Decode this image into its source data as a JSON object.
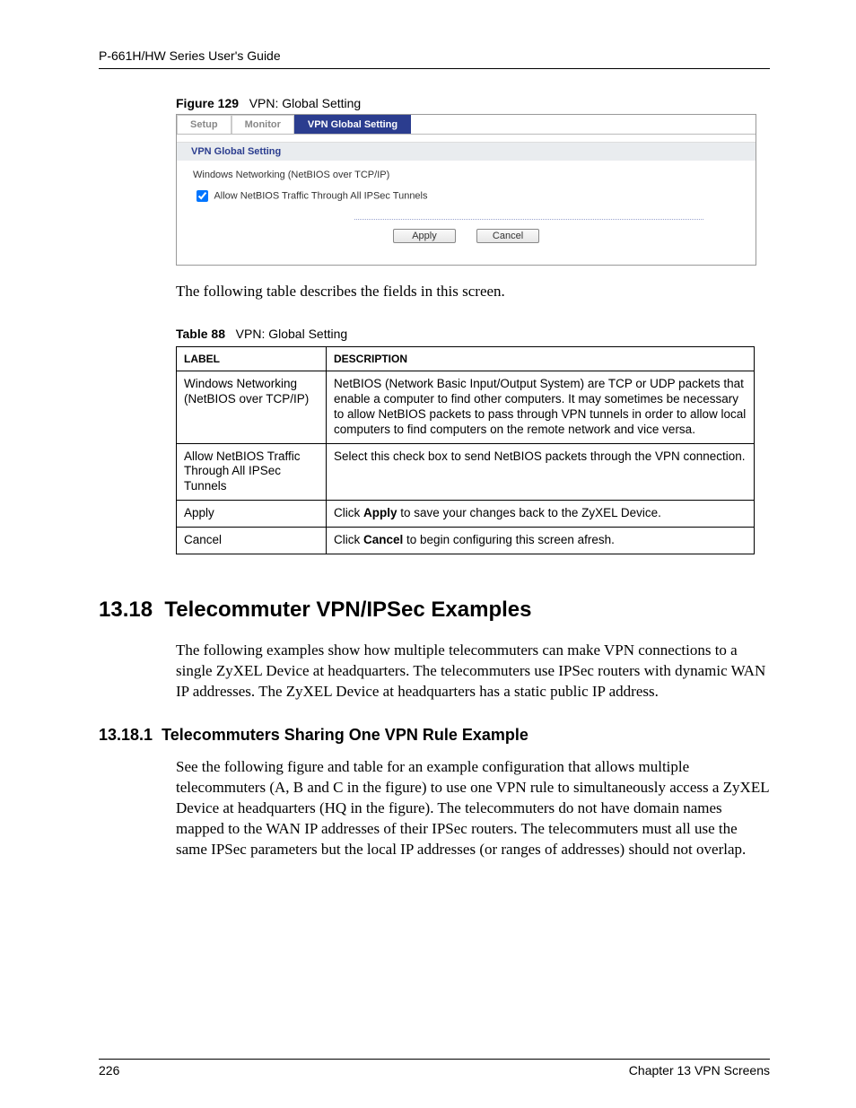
{
  "header": {
    "guide_title": "P-661H/HW Series User's Guide"
  },
  "figure": {
    "number": "Figure 129",
    "title": "VPN: Global Setting"
  },
  "ui": {
    "tabs": {
      "setup": "Setup",
      "monitor": "Monitor",
      "global": "VPN Global Setting"
    },
    "panel_title": "VPN Global Setting",
    "subhead": "Windows Networking (NetBIOS over TCP/IP)",
    "checkbox_label": "Allow NetBIOS Traffic Through All IPSec Tunnels",
    "buttons": {
      "apply": "Apply",
      "cancel": "Cancel"
    }
  },
  "intro_para": "The following table describes the fields in this screen.",
  "table_caption": {
    "number": "Table 88",
    "title": "VPN: Global Setting"
  },
  "table": {
    "headers": {
      "label": "LABEL",
      "desc": "DESCRIPTION"
    },
    "rows": [
      {
        "label": "Windows Networking (NetBIOS over TCP/IP)",
        "desc": "NetBIOS (Network Basic Input/Output System) are TCP or UDP packets that enable a computer to find other computers. It may sometimes be necessary to allow NetBIOS packets to pass through VPN tunnels in order to allow local computers to find computers on the remote network and vice versa."
      },
      {
        "label": "Allow NetBIOS Traffic Through All IPSec Tunnels",
        "desc": "Select this check box to send NetBIOS packets through the VPN connection."
      },
      {
        "label": "Apply",
        "desc_pre": "Click ",
        "desc_bold": "Apply",
        "desc_post": " to save your changes back to the ZyXEL Device."
      },
      {
        "label": "Cancel",
        "desc_pre": "Click ",
        "desc_bold": "Cancel",
        "desc_post": " to begin configuring this screen afresh."
      }
    ]
  },
  "section": {
    "number": "13.18",
    "title": "Telecommuter VPN/IPSec Examples",
    "body": "The following examples show how multiple telecommuters can make VPN connections to a single ZyXEL Device at headquarters. The telecommuters use IPSec routers with dynamic WAN IP addresses. The ZyXEL Device at headquarters has a static public IP address."
  },
  "subsection": {
    "number": "13.18.1",
    "title": "Telecommuters Sharing One VPN Rule Example",
    "body": "See the following figure and table for an example configuration that allows multiple telecommuters (A, B and C in the figure) to use one VPN rule to simultaneously access a ZyXEL Device at headquarters (HQ in the figure). The telecommuters do not have domain names mapped to the WAN IP addresses of their IPSec routers. The telecommuters must all use the same IPSec parameters but the local IP addresses (or ranges of addresses) should not overlap."
  },
  "footer": {
    "page": "226",
    "chapter": "Chapter 13 VPN Screens"
  }
}
